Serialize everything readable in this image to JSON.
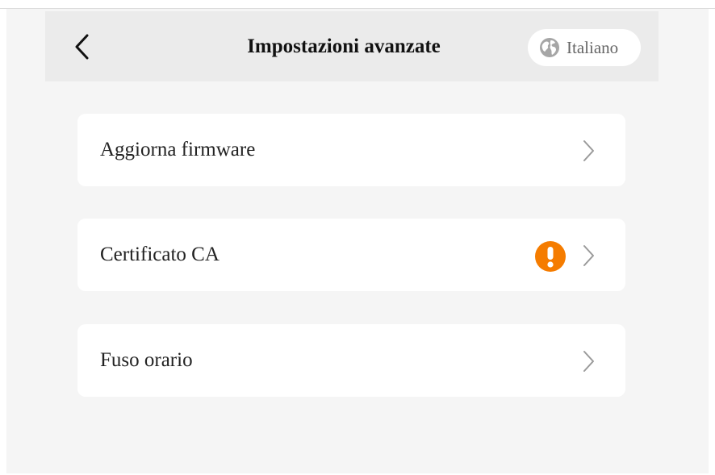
{
  "header": {
    "title": "Impostazioni avanzate",
    "back_icon": "chevron-left-icon",
    "language": {
      "label": "Italiano",
      "icon": "globe-icon"
    }
  },
  "settings": {
    "items": [
      {
        "label": "Aggiorna firmware",
        "icon": "chevron-right-icon"
      },
      {
        "label": "Certificato CA",
        "icon": "chevron-right-icon",
        "badge_icon": "warning-icon"
      },
      {
        "label": "Fuso orario",
        "icon": "chevron-right-icon"
      }
    ]
  },
  "colors": {
    "background": "#f5f5f5",
    "header": "#ebebeb",
    "card": "#ffffff",
    "warning": "#f57c00",
    "chevron": "#9a9a9a"
  }
}
